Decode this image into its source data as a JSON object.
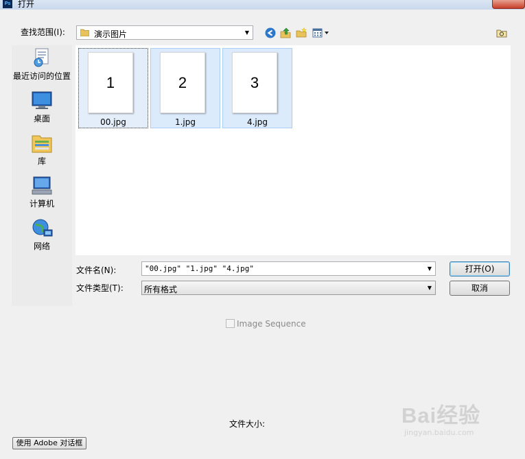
{
  "window": {
    "title": "打开",
    "app_icon": "Ps"
  },
  "look_in": {
    "label": "查找范围(I):",
    "value": "演示图片"
  },
  "places": [
    {
      "label": "最近访问的位置",
      "icon": "recent-places-icon"
    },
    {
      "label": "桌面",
      "icon": "desktop-icon"
    },
    {
      "label": "库",
      "icon": "libraries-icon"
    },
    {
      "label": "计算机",
      "icon": "computer-icon"
    },
    {
      "label": "网络",
      "icon": "network-icon"
    }
  ],
  "files": [
    {
      "name": "00.jpg",
      "thumb_text": "1"
    },
    {
      "name": "1.jpg",
      "thumb_text": "2"
    },
    {
      "name": "4.jpg",
      "thumb_text": "3"
    }
  ],
  "file_name": {
    "label": "文件名(N):",
    "value": "\"00.jpg\" \"1.jpg\" \"4.jpg\""
  },
  "file_type": {
    "label": "文件类型(T):",
    "value": "所有格式"
  },
  "buttons": {
    "open": "打开(O)",
    "cancel": "取消",
    "adobe_dialog": "使用 Adobe 对话框"
  },
  "image_sequence": {
    "label": "Image Sequence",
    "checked": false
  },
  "file_size_label": "文件大小:",
  "watermark": {
    "logo": "Bai经验",
    "url": "jingyan.baidu.com"
  }
}
